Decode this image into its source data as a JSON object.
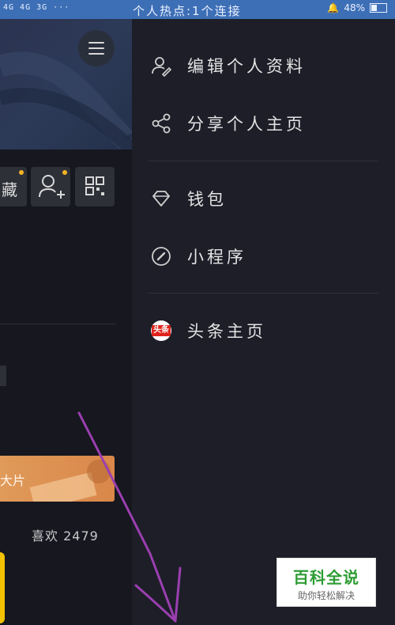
{
  "status_bar": {
    "left": "4G 4G 3G ···",
    "center": "个人热点:1个连接",
    "battery": "48%"
  },
  "left_panel": {
    "collect_label": "藏",
    "promo_text": "大片",
    "likes_text": "喜欢 2479"
  },
  "drawer": {
    "items": [
      {
        "label": "编辑个人资料",
        "icon": "edit-profile-icon"
      },
      {
        "label": "分享个人主页",
        "icon": "share-icon"
      },
      {
        "label": "钱包",
        "icon": "wallet-diamond-icon"
      },
      {
        "label": "小程序",
        "icon": "mini-program-icon"
      },
      {
        "label": "头条主页",
        "icon": "toutiao-logo-icon"
      }
    ],
    "toutiao_badge": "头条"
  },
  "watermark": {
    "title": "百科全说",
    "subtitle": "助你轻松解决"
  },
  "colors": {
    "status_bar": "#3d6fb6",
    "drawer_bg": "#1d1e28",
    "accent_yellow": "#f5b324",
    "annotation": "#9b3fb0"
  }
}
